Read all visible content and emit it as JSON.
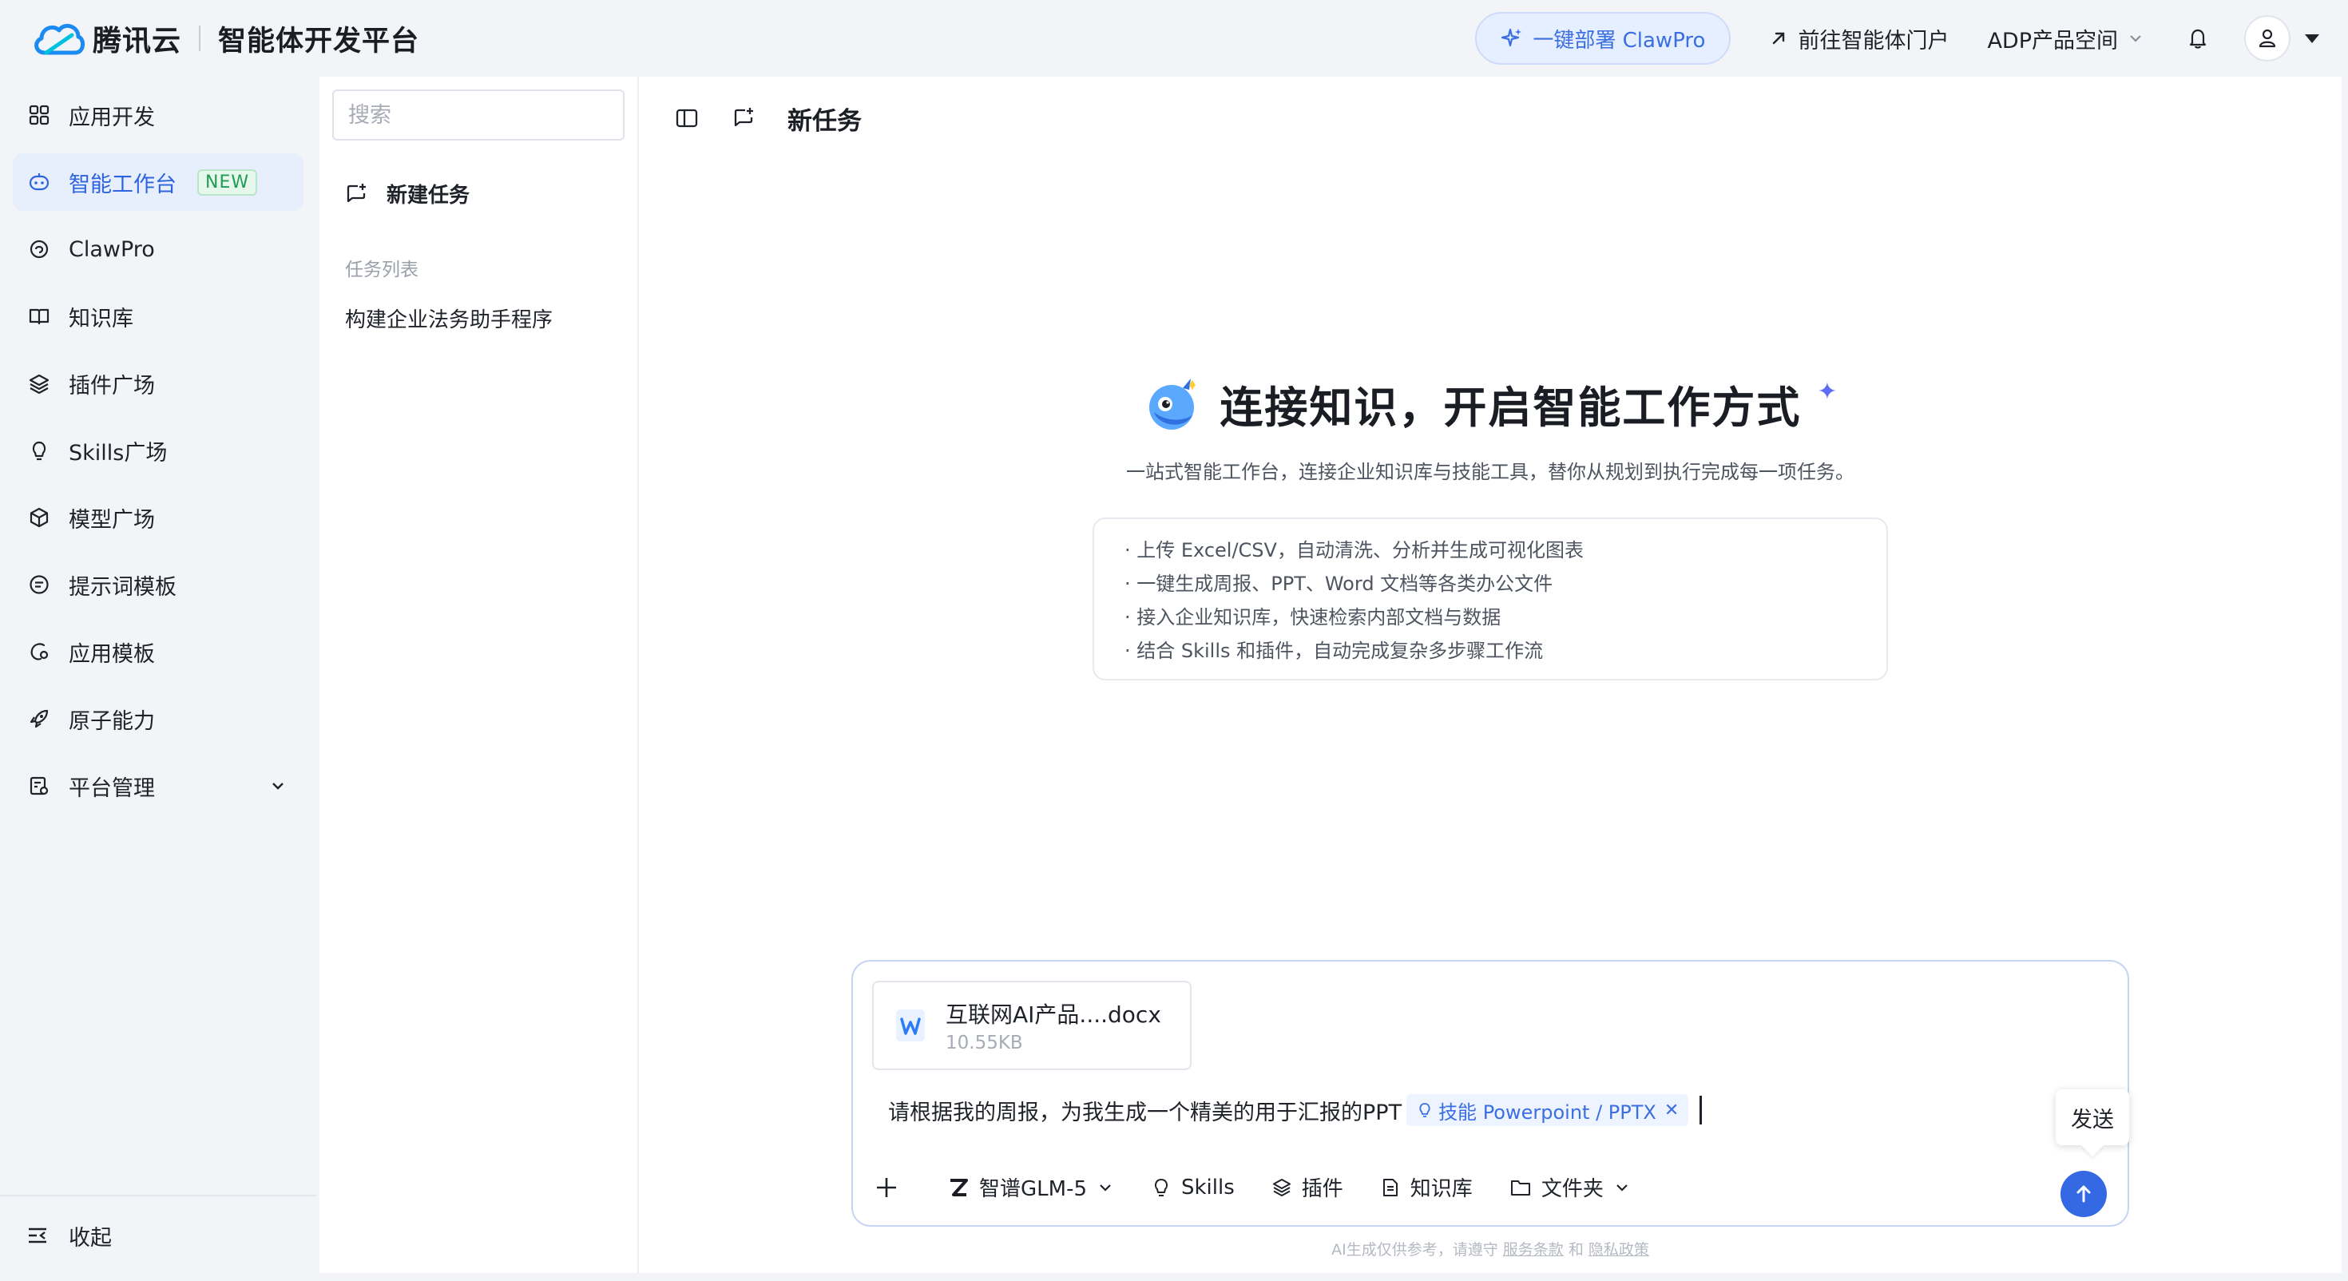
{
  "header": {
    "brand": "腾讯云",
    "platform": "智能体开发平台",
    "deploy_label": "一键部署 ClawPro",
    "portal_label": "前往智能体门户",
    "space_label": "ADP产品空间"
  },
  "sidebar": {
    "items": [
      {
        "label": "应用开发"
      },
      {
        "label": "智能工作台",
        "badge": "NEW"
      },
      {
        "label": "ClawPro"
      },
      {
        "label": "知识库"
      },
      {
        "label": "插件广场"
      },
      {
        "label": "Skills广场"
      },
      {
        "label": "模型广场"
      },
      {
        "label": "提示词模板"
      },
      {
        "label": "应用模板"
      },
      {
        "label": "原子能力"
      },
      {
        "label": "平台管理"
      }
    ],
    "collapse_label": "收起"
  },
  "tasks": {
    "search_placeholder": "搜索",
    "new_task_label": "新建任务",
    "section_title": "任务列表",
    "items": [
      "构建企业法务助手程序"
    ]
  },
  "main": {
    "title": "新任务",
    "hero_title": "连接知识，开启智能工作方式",
    "hero_subtitle": "一站式智能工作台，连接企业知识库与技能工具，替你从规划到执行完成每一项任务。",
    "features": [
      "· 上传 Excel/CSV，自动清洗、分析并生成可视化图表",
      "· 一键生成周报、PPT、Word 文档等各类办公文件",
      "· 接入企业知识库，快速检索内部文档与数据",
      "· 结合 Skills 和插件，自动完成复杂多步骤工作流"
    ]
  },
  "composer": {
    "attachment": {
      "name": "互联网AI产品....docx",
      "size": "10.55KB"
    },
    "prompt": "请根据我的周报，为我生成一个精美的用于汇报的PPT",
    "skill_tag": "技能 Powerpoint / PPTX",
    "model_label": "智谱GLM-5",
    "tools": {
      "skills": "Skills",
      "plugins": "插件",
      "knowledge": "知识库",
      "folder": "文件夹"
    },
    "send_tooltip": "发送"
  },
  "footer": {
    "disclaimer_prefix": "AI生成仅供参考，请遵守",
    "terms": "服务条款",
    "and": "和",
    "privacy": "隐私政策"
  },
  "colors": {
    "accent": "#3469e3",
    "active_bg": "#e7eefc",
    "badge_green": "#1f9d55"
  }
}
